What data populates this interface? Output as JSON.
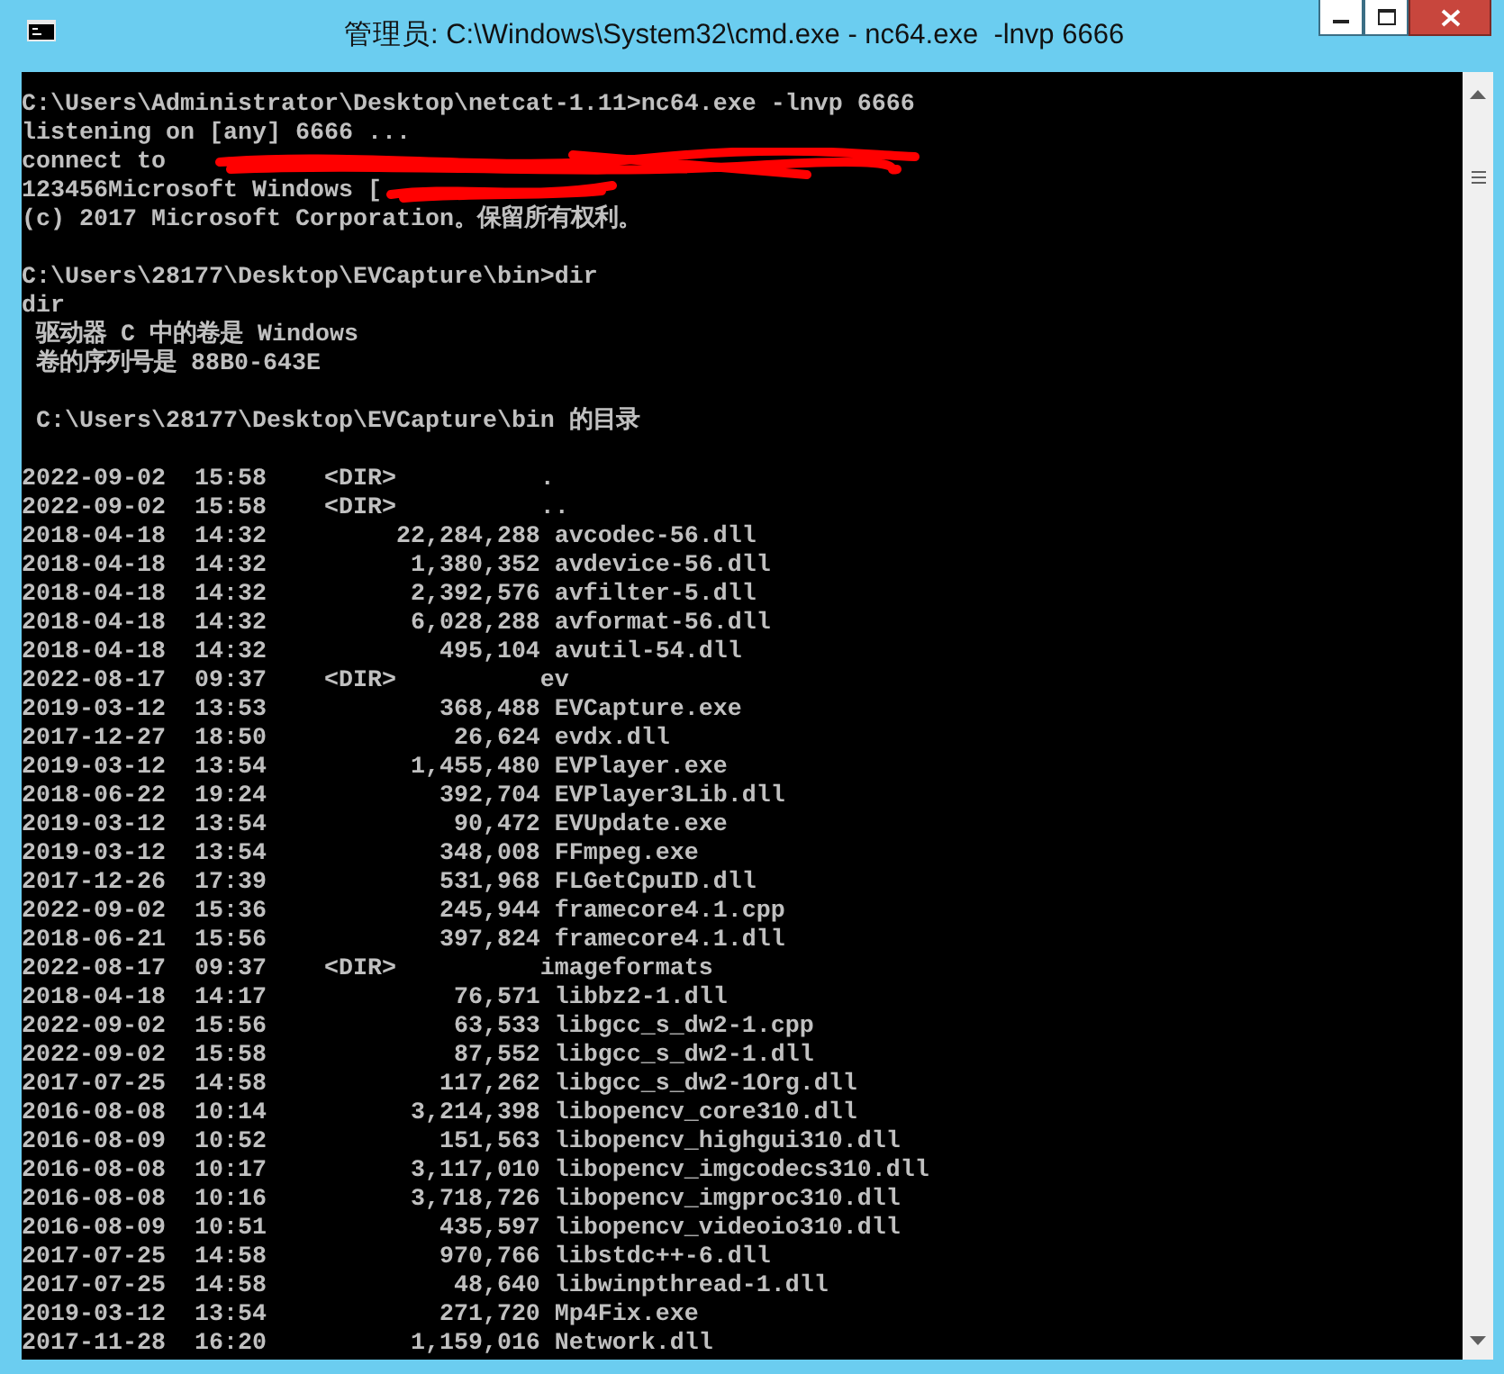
{
  "window": {
    "title": "管理员: C:\\Windows\\System32\\cmd.exe - nc64.exe  -lnvp 6666"
  },
  "console": {
    "blocks": [
      [
        "C:\\Users\\Administrator\\Desktop\\netcat-1.11>nc64.exe -lnvp 6666",
        "listening on [any] 6666 ...",
        "connect to",
        "123456Microsoft Windows [",
        "(c) 2017 Microsoft Corporation。保留所有权利。"
      ],
      [
        "C:\\Users\\28177\\Desktop\\EVCapture\\bin>dir",
        "dir",
        " 驱动器 C 中的卷是 Windows",
        " 卷的序列号是 88B0-643E"
      ],
      [
        " C:\\Users\\28177\\Desktop\\EVCapture\\bin 的目录"
      ]
    ],
    "listing": [
      {
        "kind": "dir",
        "date": "2022-09-02",
        "time": "15:58",
        "size": "<DIR>",
        "name": "."
      },
      {
        "kind": "dir",
        "date": "2022-09-02",
        "time": "15:58",
        "size": "<DIR>",
        "name": ".."
      },
      {
        "kind": "file",
        "date": "2018-04-18",
        "time": "14:32",
        "size": "22,284,288",
        "name": "avcodec-56.dll"
      },
      {
        "kind": "file",
        "date": "2018-04-18",
        "time": "14:32",
        "size": "1,380,352",
        "name": "avdevice-56.dll"
      },
      {
        "kind": "file",
        "date": "2018-04-18",
        "time": "14:32",
        "size": "2,392,576",
        "name": "avfilter-5.dll"
      },
      {
        "kind": "file",
        "date": "2018-04-18",
        "time": "14:32",
        "size": "6,028,288",
        "name": "avformat-56.dll"
      },
      {
        "kind": "file",
        "date": "2018-04-18",
        "time": "14:32",
        "size": "495,104",
        "name": "avutil-54.dll"
      },
      {
        "kind": "dir",
        "date": "2022-08-17",
        "time": "09:37",
        "size": "<DIR>",
        "name": "ev"
      },
      {
        "kind": "file",
        "date": "2019-03-12",
        "time": "13:53",
        "size": "368,488",
        "name": "EVCapture.exe"
      },
      {
        "kind": "file",
        "date": "2017-12-27",
        "time": "18:50",
        "size": "26,624",
        "name": "evdx.dll"
      },
      {
        "kind": "file",
        "date": "2019-03-12",
        "time": "13:54",
        "size": "1,455,480",
        "name": "EVPlayer.exe"
      },
      {
        "kind": "file",
        "date": "2018-06-22",
        "time": "19:24",
        "size": "392,704",
        "name": "EVPlayer3Lib.dll"
      },
      {
        "kind": "file",
        "date": "2019-03-12",
        "time": "13:54",
        "size": "90,472",
        "name": "EVUpdate.exe"
      },
      {
        "kind": "file",
        "date": "2019-03-12",
        "time": "13:54",
        "size": "348,008",
        "name": "FFmpeg.exe"
      },
      {
        "kind": "file",
        "date": "2017-12-26",
        "time": "17:39",
        "size": "531,968",
        "name": "FLGetCpuID.dll"
      },
      {
        "kind": "file",
        "date": "2022-09-02",
        "time": "15:36",
        "size": "245,944",
        "name": "framecore4.1.cpp"
      },
      {
        "kind": "file",
        "date": "2018-06-21",
        "time": "15:56",
        "size": "397,824",
        "name": "framecore4.1.dll"
      },
      {
        "kind": "dir",
        "date": "2022-08-17",
        "time": "09:37",
        "size": "<DIR>",
        "name": "imageformats"
      },
      {
        "kind": "file",
        "date": "2018-04-18",
        "time": "14:17",
        "size": "76,571",
        "name": "libbz2-1.dll"
      },
      {
        "kind": "file",
        "date": "2022-09-02",
        "time": "15:56",
        "size": "63,533",
        "name": "libgcc_s_dw2-1.cpp"
      },
      {
        "kind": "file",
        "date": "2022-09-02",
        "time": "15:58",
        "size": "87,552",
        "name": "libgcc_s_dw2-1.dll"
      },
      {
        "kind": "file",
        "date": "2017-07-25",
        "time": "14:58",
        "size": "117,262",
        "name": "libgcc_s_dw2-1Org.dll"
      },
      {
        "kind": "file",
        "date": "2016-08-08",
        "time": "10:14",
        "size": "3,214,398",
        "name": "libopencv_core310.dll"
      },
      {
        "kind": "file",
        "date": "2016-08-09",
        "time": "10:52",
        "size": "151,563",
        "name": "libopencv_highgui310.dll"
      },
      {
        "kind": "file",
        "date": "2016-08-08",
        "time": "10:17",
        "size": "3,117,010",
        "name": "libopencv_imgcodecs310.dll"
      },
      {
        "kind": "file",
        "date": "2016-08-08",
        "time": "10:16",
        "size": "3,718,726",
        "name": "libopencv_imgproc310.dll"
      },
      {
        "kind": "file",
        "date": "2016-08-09",
        "time": "10:51",
        "size": "435,597",
        "name": "libopencv_videoio310.dll"
      },
      {
        "kind": "file",
        "date": "2017-07-25",
        "time": "14:58",
        "size": "970,766",
        "name": "libstdc++-6.dll"
      },
      {
        "kind": "file",
        "date": "2017-07-25",
        "time": "14:58",
        "size": "48,640",
        "name": "libwinpthread-1.dll"
      },
      {
        "kind": "file",
        "date": "2019-03-12",
        "time": "13:54",
        "size": "271,720",
        "name": "Mp4Fix.exe"
      },
      {
        "kind": "file",
        "date": "2017-11-28",
        "time": "16:20",
        "size": "1,159,016",
        "name": "Network.dll"
      }
    ]
  }
}
